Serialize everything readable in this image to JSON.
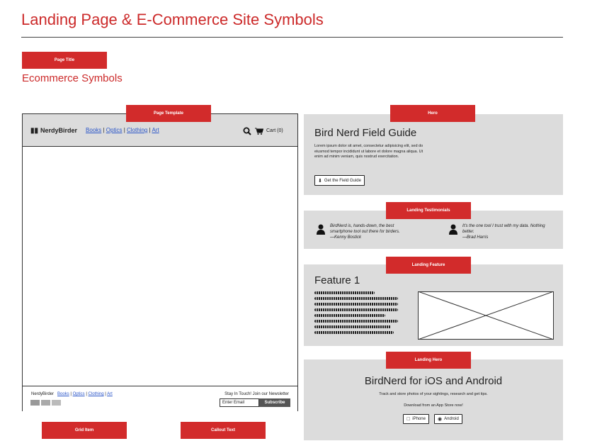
{
  "page": {
    "title": "Landing Page & E-Commerce Site Symbols",
    "subtitle": "Ecommerce Symbols"
  },
  "tags": {
    "page_title": "Page Title",
    "page_template": "Page Template",
    "hero": "Hero",
    "landing_testimonials": "Landing Testimonials",
    "landing_feature": "Landing Feature",
    "landing_hero": "Landing Hero",
    "grid_item": "Grid Item",
    "callout_text": "Callout Text"
  },
  "template": {
    "brand": "NerdyBirder",
    "nav": [
      "Books",
      "Optics",
      "Clothing",
      "Art"
    ],
    "cart_label": "Cart (0)",
    "footer_brand": "NerdyBirder",
    "footer_nav": [
      "Books",
      "Optics",
      "Clothing",
      "Art"
    ],
    "newsletter_label": "Stay In Touch! Join our Newsletter",
    "email_placeholder": "Enter Email",
    "subscribe_label": "Subscribe"
  },
  "hero": {
    "heading": "Bird Nerd Field Guide",
    "body": "Lorem ipsum dolor sit amet, consectetur adipisicing elit, sed do eiusmod tempor incididunt ut labore et dolore magna aliqua. Ut enim ad minim veniam, quis nostrud exercitation.",
    "button_label": "Get the Field Guide"
  },
  "testimonials": [
    {
      "quote": "BirdNerd is, hands-down, the best smartphone tool out there for birders.",
      "author": "—Kenny Bostick"
    },
    {
      "quote": "It's the one tool I trust with my data. Nothing better.",
      "author": "—Brad Harris"
    }
  ],
  "feature": {
    "heading": "Feature 1"
  },
  "landing_hero": {
    "heading": "BirdNerd for iOS and Android",
    "subtext": "Track and store photos of your sightings, research and get tips.",
    "download_text": "Download from an App Store now!",
    "iphone_label": "iPhone",
    "android_label": "Android"
  },
  "colors": {
    "accent": "#d22b2b",
    "panel": "#dcdcdc",
    "link": "#2a55c8"
  }
}
